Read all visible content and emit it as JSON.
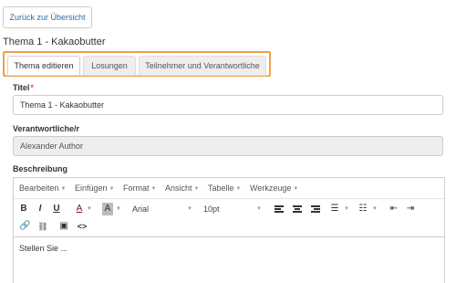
{
  "nav": {
    "back_label": "Zurück zur Übersicht"
  },
  "topic": {
    "title": "Thema 1 - Kakaobutter"
  },
  "tabs": [
    {
      "label": "Thema editieren",
      "active": true
    },
    {
      "label": "Losungen",
      "active": false
    },
    {
      "label": "Teilnehmer und Verantwortliche",
      "active": false
    }
  ],
  "form": {
    "title_label": "Titel",
    "required_mark": "*",
    "title_value": "Thema 1 - Kakaobutter",
    "responsible_label": "Verantwortliche/r",
    "responsible_value": "Alexander Author",
    "description_label": "Beschreibung"
  },
  "editor": {
    "menus": [
      "Bearbeiten",
      "Einfügen",
      "Format",
      "Ansicht",
      "Tabelle",
      "Werkzeuge"
    ],
    "toolbar": {
      "bold": "B",
      "italic": "I",
      "underline": "U",
      "font_color": "A",
      "bg_color": "A",
      "font_family": "Arial",
      "font_size": "10pt",
      "source_code": "<>"
    },
    "content": "Stellen Sie ..."
  },
  "colors": {
    "highlight": "#f0a04b",
    "link": "#2b6ea8",
    "required": "#d9534f"
  }
}
